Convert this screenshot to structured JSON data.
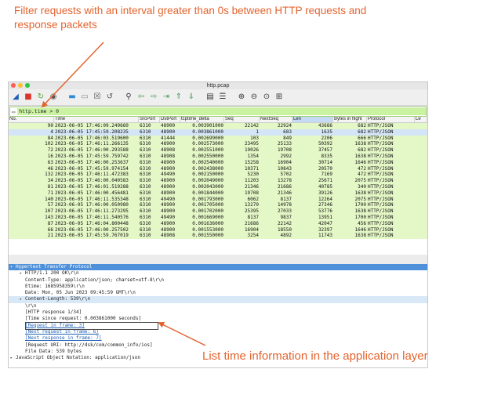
{
  "annotations": {
    "top": "Filter requests with an interval greater than 0s between HTTP requests and response packets",
    "bottom": "List time information in the application layer",
    "color": "#e3642f"
  },
  "window": {
    "title": "http.pcap",
    "lights": [
      "#ff5f57",
      "#febc2e",
      "#28c840"
    ]
  },
  "toolbar": {
    "icons": [
      {
        "name": "shark-fin-icon",
        "glyph": "◢",
        "color": "#1d5fb4"
      },
      {
        "name": "stop-icon",
        "glyph": "■",
        "color": "#d9362b"
      },
      {
        "name": "restart-icon",
        "glyph": "↻",
        "color": "#5aa53a"
      },
      {
        "name": "options-icon",
        "glyph": "◉",
        "color": "#555555"
      },
      {
        "name": "open-folder-icon",
        "glyph": "▬",
        "color": "#2a8bd8"
      },
      {
        "name": "save-icon",
        "glyph": "▭",
        "color": "#888888"
      },
      {
        "name": "close-file-icon",
        "glyph": "☒",
        "color": "#555555"
      },
      {
        "name": "reload-icon",
        "glyph": "↺",
        "color": "#555555"
      },
      {
        "name": "find-icon",
        "glyph": "⚲",
        "color": "#333333"
      },
      {
        "name": "back-icon",
        "glyph": "⇦",
        "color": "#4aa05a"
      },
      {
        "name": "forward-icon",
        "glyph": "⇨",
        "color": "#4aa05a"
      },
      {
        "name": "goto-icon",
        "glyph": "⇥",
        "color": "#4aa05a"
      },
      {
        "name": "first-packet-icon",
        "glyph": "⇑",
        "color": "#4aa05a"
      },
      {
        "name": "last-packet-icon",
        "glyph": "⇓",
        "color": "#4aa05a"
      },
      {
        "name": "autoscroll-icon",
        "glyph": "▤",
        "color": "#333333"
      },
      {
        "name": "colorize-icon",
        "glyph": "☰",
        "color": "#333333"
      },
      {
        "name": "zoom-in-icon",
        "glyph": "⊕",
        "color": "#333333"
      },
      {
        "name": "zoom-out-icon",
        "glyph": "⊖",
        "color": "#333333"
      },
      {
        "name": "zoom-normal-icon",
        "glyph": "⊙",
        "color": "#333333"
      },
      {
        "name": "resize-columns-icon",
        "glyph": "⊞",
        "color": "#333333"
      }
    ]
  },
  "filter": {
    "value": "http.time > 0"
  },
  "columns": [
    "No.",
    "Time",
    "SrcPort",
    "DstPort",
    "tcptime_delta",
    "Seq",
    "NextSeq",
    "Len",
    "Bytes in flight",
    "Protocol",
    "Le"
  ],
  "packets": [
    [
      "90",
      "2023-06-05 17:46:09.249660",
      "6310",
      "48900",
      "0.003901000",
      "22142",
      "22924",
      "43686",
      "682",
      "HTTP/JSON"
    ],
    [
      "4",
      "2023-06-05 17:45:59.208235",
      "6310",
      "48900",
      "0.003861000",
      "1",
      "683",
      "1635",
      "682",
      "HTTP/JSON"
    ],
    [
      "84",
      "2023-06-05 17:46:03.519600",
      "6310",
      "41444",
      "0.002699000",
      "103",
      "849",
      "2206",
      "666",
      "HTTP/JSON"
    ],
    [
      "102",
      "2023-06-05 17:46:11.266135",
      "6310",
      "48900",
      "0.002573000",
      "23495",
      "25133",
      "50392",
      "1638",
      "HTTP/JSON"
    ],
    [
      "72",
      "2023-06-05 17:46:00.293588",
      "6310",
      "48908",
      "0.002551000",
      "19026",
      "19708",
      "37457",
      "682",
      "HTTP/JSON"
    ],
    [
      "16",
      "2023-06-05 17:45:59.759742",
      "6310",
      "48908",
      "0.002550000",
      "1354",
      "2992",
      "8335",
      "1638",
      "HTTP/JSON"
    ],
    [
      "63",
      "2023-06-05 17:46:00.253637",
      "6310",
      "48900",
      "0.002540000",
      "15258",
      "16904",
      "30714",
      "1646",
      "HTTP/JSON"
    ],
    [
      "46",
      "2023-06-05 17:45:59.974154",
      "6310",
      "48900",
      "0.002438000",
      "10371",
      "10843",
      "20570",
      "472",
      "HTTP/JSON"
    ],
    [
      "132",
      "2023-06-05 17:46:11.472383",
      "6310",
      "49490",
      "0.002150000",
      "5230",
      "5702",
      "7169",
      "472",
      "HTTP/JSON"
    ],
    [
      "34",
      "2023-06-05 17:46:00.040583",
      "6310",
      "48900",
      "0.002049000",
      "11203",
      "13278",
      "25671",
      "2075",
      "HTTP/JSON"
    ],
    [
      "81",
      "2023-06-05 17:46:01.519288",
      "6310",
      "48900",
      "0.002043000",
      "21346",
      "21686",
      "40785",
      "340",
      "HTTP/JSON"
    ],
    [
      "71",
      "2023-06-05 17:46:00.456481",
      "6310",
      "48900",
      "0.001844000",
      "19708",
      "21346",
      "39126",
      "1638",
      "HTTP/JSON"
    ],
    [
      "140",
      "2023-06-05 17:46:11.535348",
      "6310",
      "49490",
      "0.001793000",
      "6062",
      "8137",
      "12264",
      "2075",
      "HTTP/JSON"
    ],
    [
      "57",
      "2023-06-05 17:46:00.050980",
      "6310",
      "48900",
      "0.001705000",
      "13270",
      "14978",
      "27346",
      "1700",
      "HTTP/JSON"
    ],
    [
      "107",
      "2023-06-05 17:46:11.273295",
      "6310",
      "48900",
      "0.001702000",
      "25395",
      "27033",
      "53776",
      "1638",
      "HTTP/JSON"
    ],
    [
      "143",
      "2023-06-05 17:46:11.540576",
      "6310",
      "49490",
      "0.001669000",
      "8137",
      "9837",
      "13951",
      "1700",
      "HTTP/JSON"
    ],
    [
      "87",
      "2023-06-05 17:46:04.800448",
      "6310",
      "48900",
      "0.001636000",
      "21686",
      "22142",
      "42047",
      "456",
      "HTTP/JSON"
    ],
    [
      "66",
      "2023-06-05 17:46:00.257502",
      "6310",
      "48900",
      "0.001553000",
      "16904",
      "18550",
      "32397",
      "1646",
      "HTTP/JSON"
    ],
    [
      "21",
      "2023-06-05 17:45:59.767019",
      "6310",
      "48908",
      "0.001550000",
      "3254",
      "4892",
      "11743",
      "1638",
      "HTTP/JSON"
    ]
  ],
  "selected_row_index": 1,
  "detail": [
    {
      "text": "Hypertext Transfer Protocol",
      "level": 0,
      "state": "selected",
      "tri": "▾"
    },
    {
      "text": "HTTP/1.1 200 OK\\r\\n",
      "level": 1,
      "state": "normal",
      "tri": "▸"
    },
    {
      "text": "Content-Type: application/json; charset=utf-8\\r\\n",
      "level": 1,
      "state": "normal",
      "tri": ""
    },
    {
      "text": "Etime: 1685958359\\r\\n",
      "level": 1,
      "state": "normal",
      "tri": ""
    },
    {
      "text": "Date: Mon, 05 Jun 2023 09:45:59 GMT\\r\\n",
      "level": 1,
      "state": "normal",
      "tri": ""
    },
    {
      "text": "Content-Length: 539\\r\\n",
      "level": 1,
      "state": "highlight",
      "tri": "▸"
    },
    {
      "text": "\\r\\n",
      "level": 1,
      "state": "normal",
      "tri": ""
    },
    {
      "text": "[HTTP response 1/34]",
      "level": 1,
      "state": "normal",
      "tri": ""
    },
    {
      "text": "[Time since request: 0.003861000 seconds]",
      "level": 1,
      "state": "normal",
      "tri": ""
    },
    {
      "text": "[Request in frame: 3]",
      "level": 1,
      "state": "link",
      "tri": ""
    },
    {
      "text": "[Next request in frame: 6]",
      "level": 1,
      "state": "link",
      "tri": ""
    },
    {
      "text": "[Next response in frame: 7]",
      "level": 1,
      "state": "link",
      "tri": ""
    },
    {
      "text": "[Request URI: http://dsk/com/common_info/ios]",
      "level": 1,
      "state": "normal",
      "tri": ""
    },
    {
      "text": "File Data: 539 bytes",
      "level": 1,
      "state": "normal",
      "tri": ""
    },
    {
      "text": "JavaScript Object Notation: application/json",
      "level": 0,
      "state": "normal",
      "tri": "▸"
    }
  ]
}
